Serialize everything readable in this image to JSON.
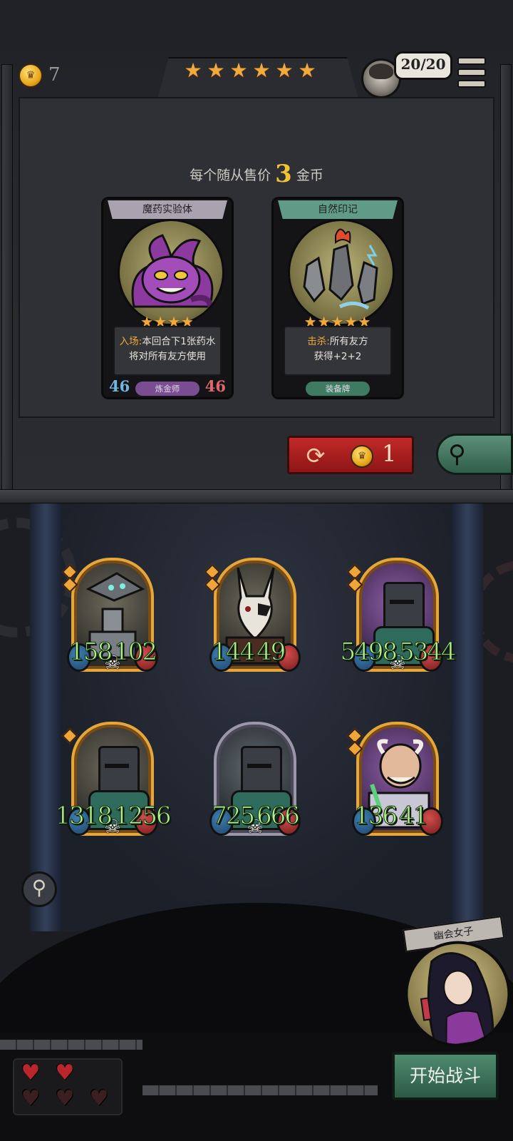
{
  "shop": {
    "gold": "7",
    "tier_stars": [
      "★",
      "★",
      "★",
      "★",
      "★",
      "★"
    ],
    "player_count": "20/20",
    "sell_price": {
      "prefix": "每个随从售价",
      "amount": "3",
      "suffix": "金币"
    },
    "offers": [
      {
        "name": "魔药实验体",
        "stars": "★★★★",
        "desc_keyword": "入场:",
        "desc_line1": "本回合下1张药水",
        "desc_line2": "将对所有友方使用",
        "tag": "炼金师",
        "attack": "46",
        "health": "46"
      },
      {
        "name": "自然印记",
        "stars": "★★★★★",
        "desc_keyword": "击杀:",
        "desc_line1": "所有友方",
        "desc_line2": "获得+2+2",
        "tag": "装备牌"
      }
    ],
    "refresh_cost": "1",
    "refresh_icon": "refresh-icon",
    "search_icon": "magnifier-icon"
  },
  "board": {
    "minions": [
      {
        "attack": "158",
        "health": "102",
        "frame": "gold"
      },
      {
        "attack": "144",
        "health": "49",
        "frame": "gold"
      },
      {
        "attack": "5498",
        "health": "5344",
        "frame": "gold"
      },
      {
        "attack": "1318",
        "health": "1256",
        "frame": "gold"
      },
      {
        "attack": "725",
        "health": "666",
        "frame": "silver"
      },
      {
        "attack": "136",
        "health": "41",
        "frame": "gold"
      }
    ],
    "skull_icon": "skull-icon"
  },
  "hero": {
    "name": "幽会女子",
    "start_label": "开始战斗"
  },
  "lives": {
    "full": 2,
    "empty": 3
  },
  "colors": {
    "stat_green": "#b7f08f",
    "gold": "#f2a93b",
    "refresh_red": "#c12a28",
    "start_green": "#4f8a6e"
  }
}
